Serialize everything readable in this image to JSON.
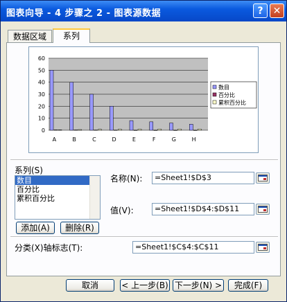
{
  "window": {
    "title": "图表向导 - 4 步骤之 2 - 图表源数据"
  },
  "title_buttons": {
    "help": "?",
    "close": "✕"
  },
  "tabs": [
    {
      "label": "数据区域"
    },
    {
      "label": "系列"
    }
  ],
  "chart_data": {
    "type": "bar",
    "categories": [
      "A",
      "B",
      "C",
      "D",
      "E",
      "F",
      "G",
      "H"
    ],
    "series": [
      {
        "name": "数目",
        "values": [
          50,
          40,
          30,
          20,
          8,
          7,
          6,
          5
        ],
        "color": "#9999ff"
      },
      {
        "name": "百分比",
        "values": [
          0.3,
          0.24,
          0.18,
          0.12,
          0.05,
          0.04,
          0.04,
          0.03
        ],
        "color": "#993366"
      },
      {
        "name": "累积百分比",
        "values": [
          0.3,
          0.54,
          0.72,
          0.84,
          0.89,
          0.93,
          0.97,
          1.0
        ],
        "color": "#ffffcc"
      }
    ],
    "y_ticks": [
      "0",
      "10",
      "20",
      "30",
      "40",
      "50",
      "60"
    ],
    "ylim": [
      0,
      60
    ],
    "plot_background": "#c0c0c0",
    "grid": true,
    "legend_position": "right"
  },
  "series_section": {
    "label": "系列(S)",
    "items": [
      "数目",
      "百分比",
      "累积百分比"
    ],
    "add_button": "添加(A)",
    "remove_button": "删除(R)"
  },
  "name_field": {
    "label": "名称(N):",
    "value": "=Sheet1!$D$3"
  },
  "value_field": {
    "label": "值(V):",
    "value": "=Sheet1!$D$4:$D$11"
  },
  "category_field": {
    "label": "分类(X)轴标志(T):",
    "value": "=Sheet1!$C$4:$C$11"
  },
  "footer": {
    "cancel": "取消",
    "back": "< 上一步(B)",
    "next": "下一步(N) >",
    "finish": "完成(F)"
  }
}
